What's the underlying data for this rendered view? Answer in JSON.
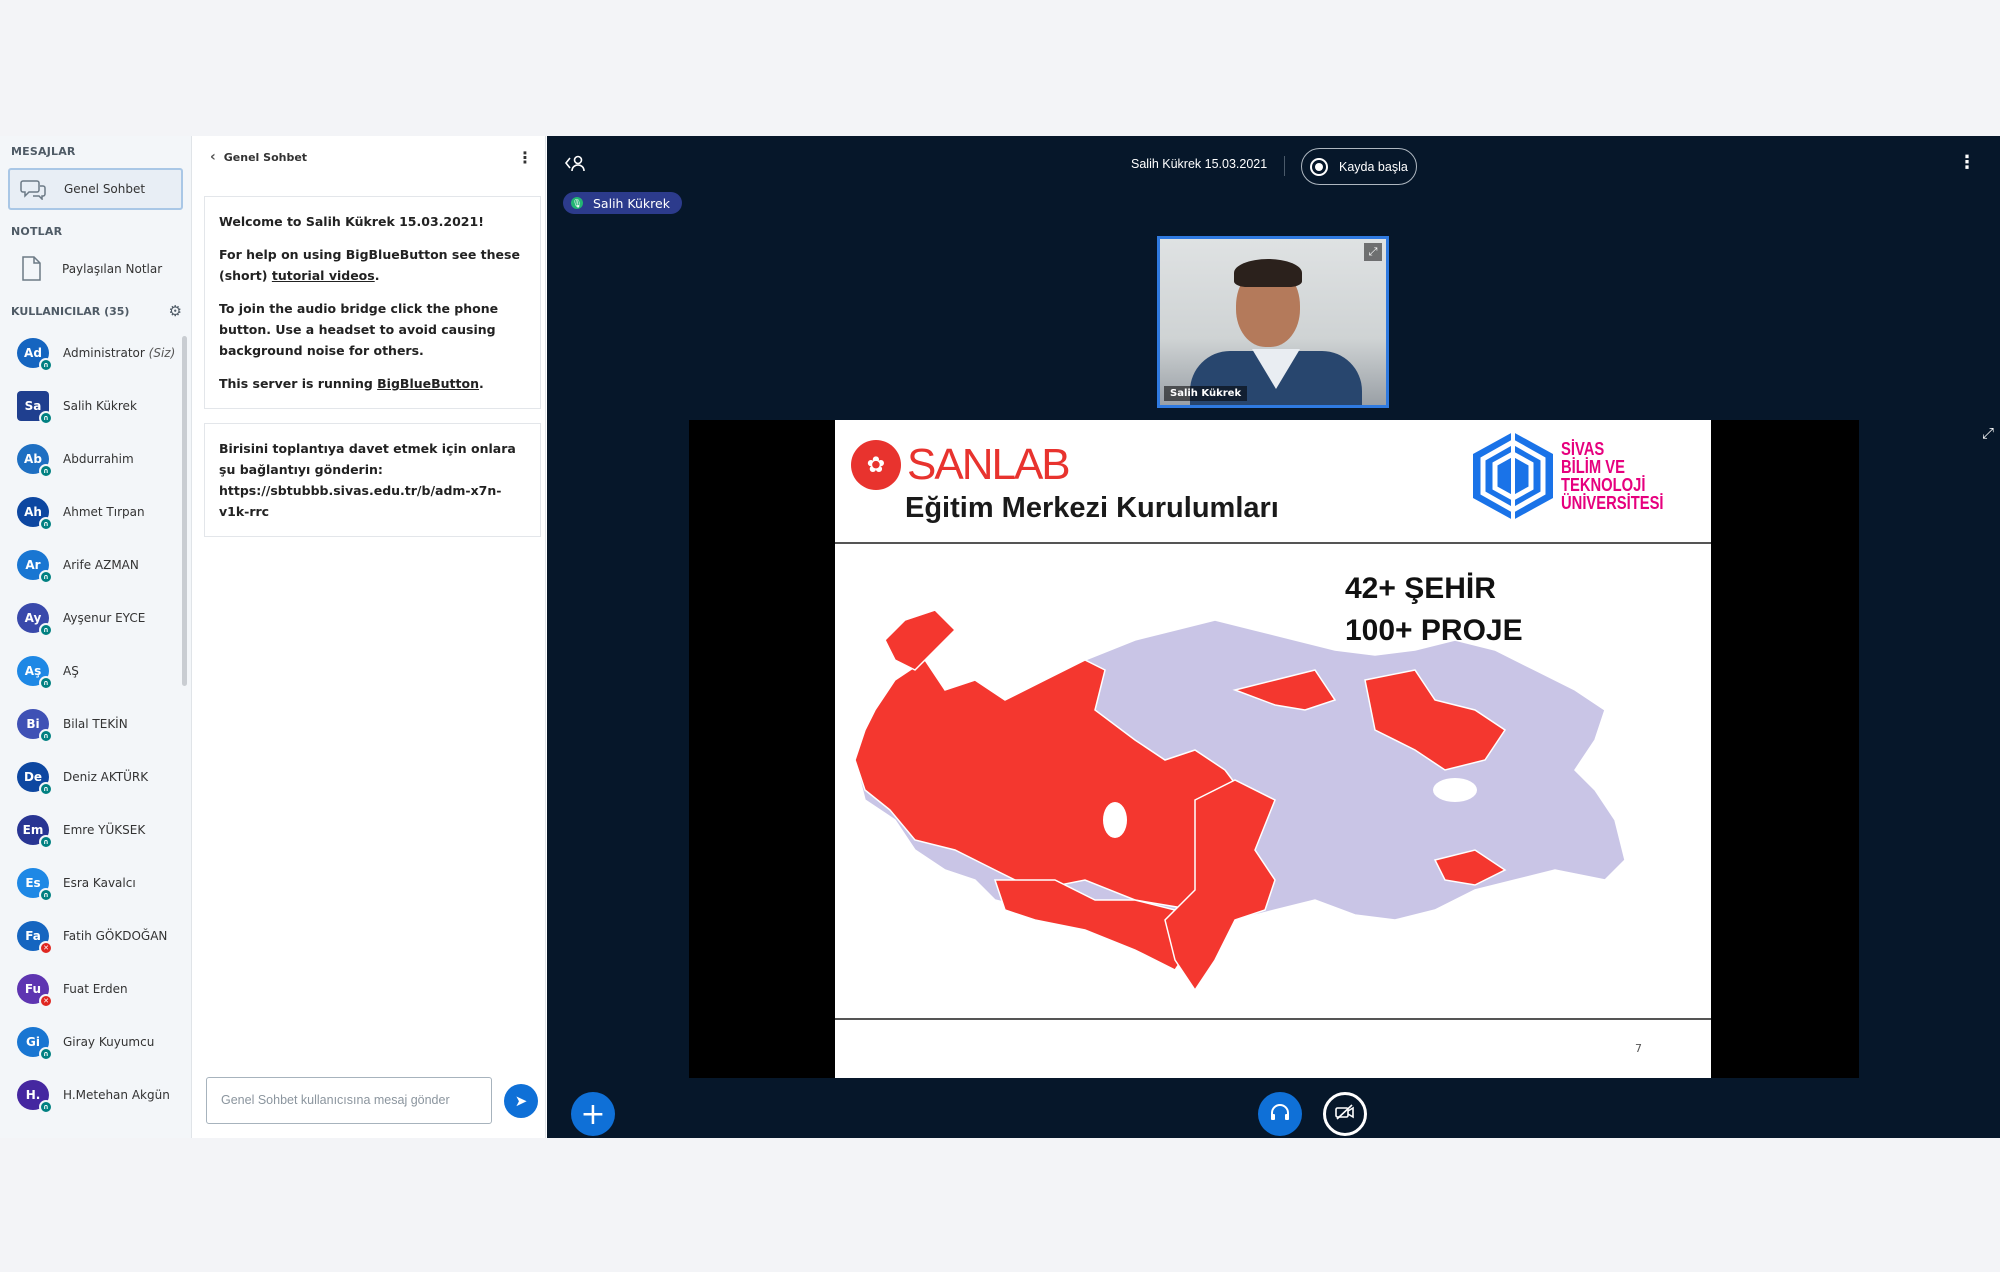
{
  "sidebar": {
    "messages_label": "MESAJLAR",
    "public_chat": "Genel Sohbet",
    "notes_label": "NOTLAR",
    "shared_notes": "Paylaşılan Notlar",
    "users_label": "KULLANICILAR (35)",
    "users": [
      {
        "initials": "Ad",
        "name": "Administrator",
        "you": "(Siz)",
        "color": "#1565c0",
        "muted": false
      },
      {
        "initials": "Sa",
        "name": "Salih Kükrek",
        "you": "",
        "color": "#1f3f8f",
        "muted": false
      },
      {
        "initials": "Ab",
        "name": "Abdurrahim",
        "you": "",
        "color": "#1e6fc2",
        "muted": false
      },
      {
        "initials": "Ah",
        "name": "Ahmet Tırpan",
        "you": "",
        "color": "#0d47a1",
        "muted": false
      },
      {
        "initials": "Ar",
        "name": "Arife AZMAN",
        "you": "",
        "color": "#1976d2",
        "muted": false
      },
      {
        "initials": "Ay",
        "name": "Ayşenur EYCE",
        "you": "",
        "color": "#3949ab",
        "muted": false
      },
      {
        "initials": "Aş",
        "name": "AŞ",
        "you": "",
        "color": "#1e88e5",
        "muted": false
      },
      {
        "initials": "Bi",
        "name": "Bilal TEKİN",
        "you": "",
        "color": "#3f51b5",
        "muted": false
      },
      {
        "initials": "De",
        "name": "Deniz AKTÜRK",
        "you": "",
        "color": "#0d47a1",
        "muted": false
      },
      {
        "initials": "Em",
        "name": "Emre YÜKSEK",
        "you": "",
        "color": "#283593",
        "muted": false
      },
      {
        "initials": "Es",
        "name": "Esra Kavalcı",
        "you": "",
        "color": "#1e88e5",
        "muted": false
      },
      {
        "initials": "Fa",
        "name": "Fatih GÖKDOĞAN",
        "you": "",
        "color": "#1565c0",
        "muted": true
      },
      {
        "initials": "Fu",
        "name": "Fuat Erden",
        "you": "",
        "color": "#5e35b1",
        "muted": true
      },
      {
        "initials": "Gi",
        "name": "Giray Kuyumcu",
        "you": "",
        "color": "#1976d2",
        "muted": false
      },
      {
        "initials": "H.",
        "name": "H.Metehan Akgün",
        "you": "",
        "color": "#4527a0",
        "muted": false
      }
    ]
  },
  "chat": {
    "title": "Genel Sohbet",
    "welcome_title": "Welcome to Salih Kükrek 15.03.2021!",
    "help_prefix": "For help on using BigBlueButton see these (short) ",
    "help_link": "tutorial videos",
    "help_suffix": ".",
    "audio_text": "To join the audio bridge click the phone button. Use a headset to avoid causing background noise for others.",
    "server_prefix": "This server is running ",
    "server_link": "BigBlueButton",
    "server_suffix": ".",
    "invite_text": "Birisini toplantıya davet etmek için onlara şu bağlantıyı gönderin:",
    "invite_url": "https://sbtubbb.sivas.edu.tr/b/adm-x7n-v1k-rrc",
    "input_placeholder": "Genel Sohbet kullanıcısına mesaj gönder"
  },
  "main": {
    "meeting_title": "Salih Kükrek 15.03.2021",
    "record_label": "Kayda başla",
    "talking_user": "Salih Kükrek",
    "webcam_name": "Salih Kükrek"
  },
  "slide": {
    "logo_text": "SANLAB",
    "title": "Eğitim Merkezi Kurulumları",
    "uni_line1": "SİVAS",
    "uni_line2": "BİLİM VE TEKNOLOJİ",
    "uni_line3": "ÜNİVERSİTESİ",
    "stat1": "42+ ŞEHİR",
    "stat2": "100+ PROJE",
    "page": "7",
    "colors": {
      "active": "#f4372f",
      "inactive": "#c9c5e6"
    }
  }
}
